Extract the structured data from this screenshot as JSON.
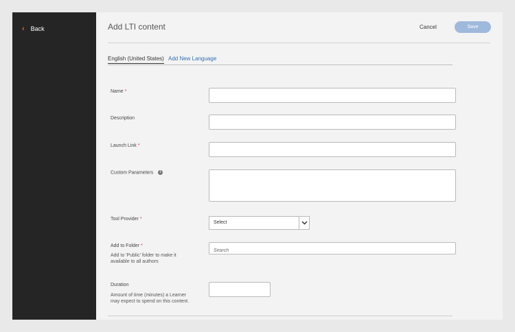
{
  "sidebar": {
    "back_label": "Back"
  },
  "header": {
    "title": "Add LTI content",
    "cancel_label": "Cancel",
    "save_label": "Save"
  },
  "tabs": [
    {
      "label": "English (United States)"
    },
    {
      "label": "Add New Language"
    }
  ],
  "form": {
    "name_label": "Name",
    "description_label": "Description",
    "launch_link_label": "Launch Link",
    "custom_params_label": "Custom Parameters",
    "tool_provider_label": "Tool Provider",
    "tool_provider_value": "Select",
    "add_to_folder_label": "Add to Folder",
    "add_to_folder_hint": "Add to 'Public' folder to make it available to all authors",
    "folder_search_placeholder": "Search",
    "duration_label": "Duration",
    "duration_hint": "Amount of time (minutes) a Learner may expect to spend on this content.",
    "required_mark": "*"
  },
  "colors": {
    "sidebar_bg": "#252525",
    "accent": "#e8602c",
    "save_bg": "#9fb9dc",
    "link": "#2e6fb6",
    "required": "#d7373f"
  }
}
